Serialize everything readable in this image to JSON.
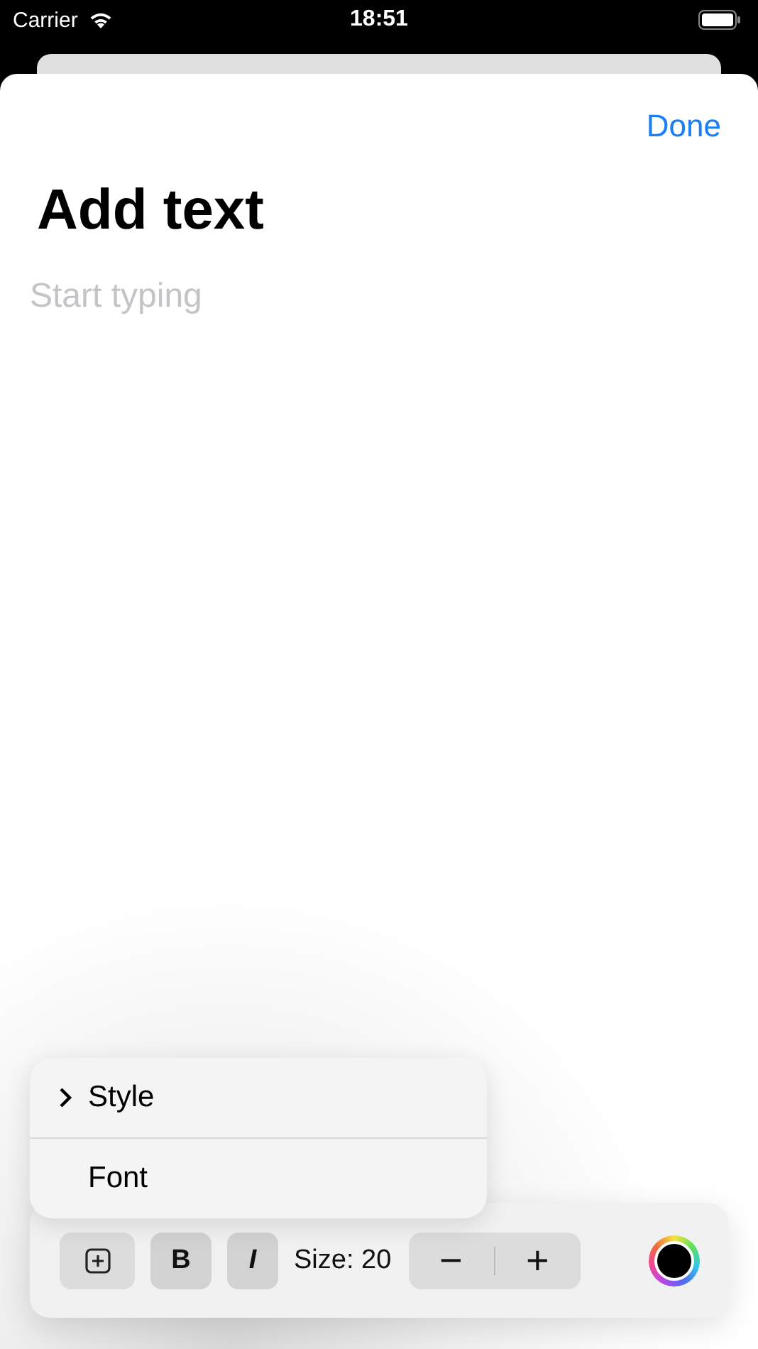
{
  "status_bar": {
    "carrier": "Carrier",
    "time": "18:51"
  },
  "nav": {
    "done": "Done"
  },
  "title": "Add text",
  "editor": {
    "placeholder": "Start typing"
  },
  "menu": [
    {
      "label": "Style",
      "expandable": true
    },
    {
      "label": "Font",
      "expandable": false
    }
  ],
  "toolbar": {
    "bold": "B",
    "italic": "I",
    "size_label": "Size: 20",
    "decrease": "−",
    "increase": "+"
  }
}
